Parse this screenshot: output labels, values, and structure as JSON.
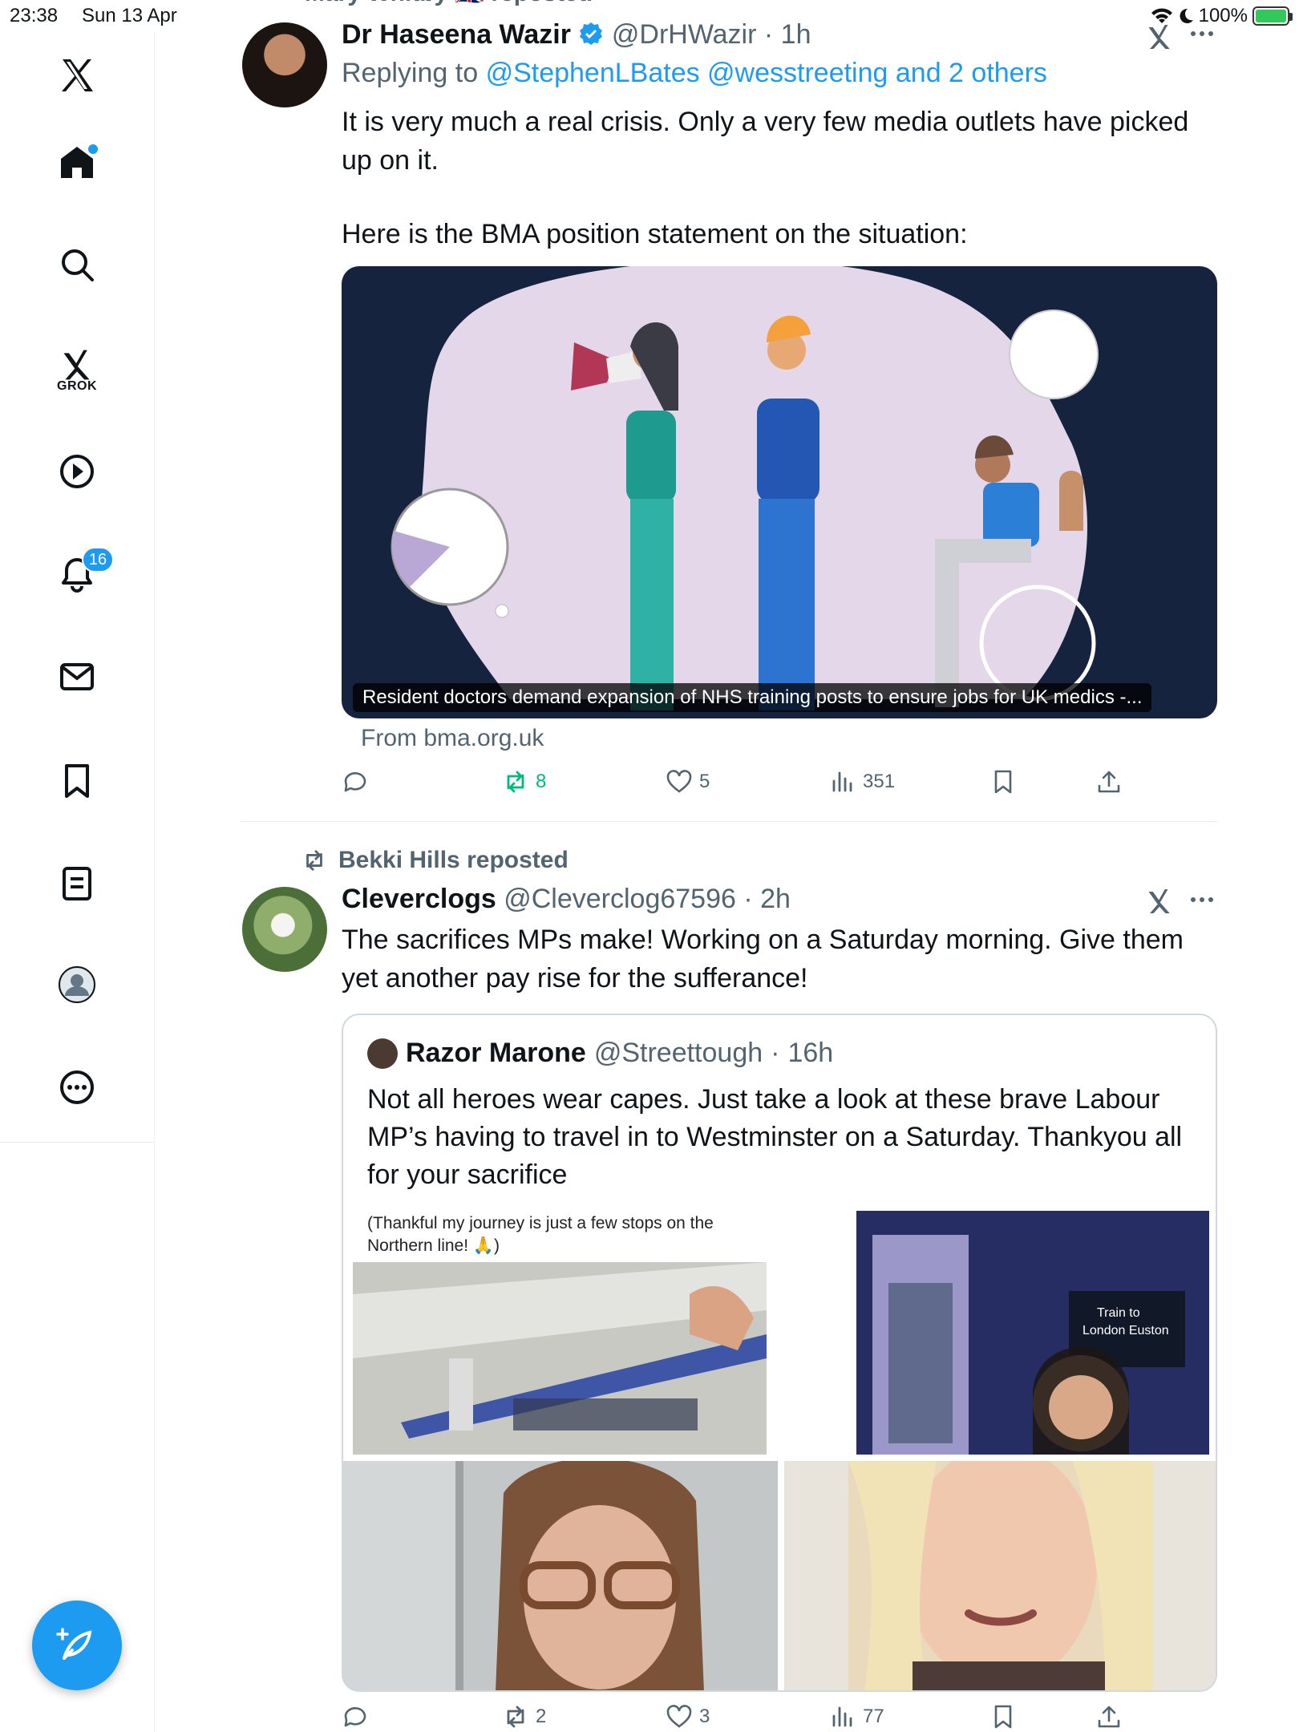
{
  "status_bar": {
    "time": "23:38",
    "date": "Sun 13 Apr",
    "battery": "100%"
  },
  "sidebar": {
    "grok_label": "GROK",
    "notification_count": "16"
  },
  "tweet1": {
    "repost_banner": "Mary Whitby 🇬🇧 reposted",
    "name": "Dr Haseena Wazir",
    "handle": "@DrHWazir",
    "time": "1h",
    "replying_prefix": "Replying to",
    "replying_to": "@StephenLBates @wesstreeting and 2 others",
    "text_line1": "It is very much a real crisis. Only a very few media outlets have picked",
    "text_line2": "up on it.",
    "text_line3": "Here is the BMA position statement on the situation:",
    "card_caption": "Resident doctors demand expansion of NHS training posts to ensure jobs for UK medics  -...",
    "card_source": "From bma.org.uk",
    "replies": "",
    "reposts": "8",
    "likes": "5",
    "views": "351"
  },
  "tweet2": {
    "repost_banner": "Bekki Hills reposted",
    "name": "Cleverclogs",
    "handle": "@Cleverclog67596",
    "time": "2h",
    "text_line1": "The sacrifices MPs make! Working on a Saturday morning. Give them",
    "text_line2": "yet another pay rise for the sufferance!",
    "quote": {
      "name": "Razor Marone",
      "handle": "@Streettough",
      "time": "16h",
      "text": "Not all heroes wear capes. Just take a look at these brave Labour MP’s having to travel in to Westminster on a Saturday. Thankyou all for your sacrifice",
      "img1_caption": "(Thankful my journey is just a few stops on the Northern line! 🙏)",
      "img2_sign": "Train to London Euston"
    },
    "reposts": "2",
    "likes": "3",
    "views": "77"
  },
  "colors": {
    "accent": "#1d9bf0",
    "repost_green": "#00ba7c",
    "muted": "#536471"
  }
}
